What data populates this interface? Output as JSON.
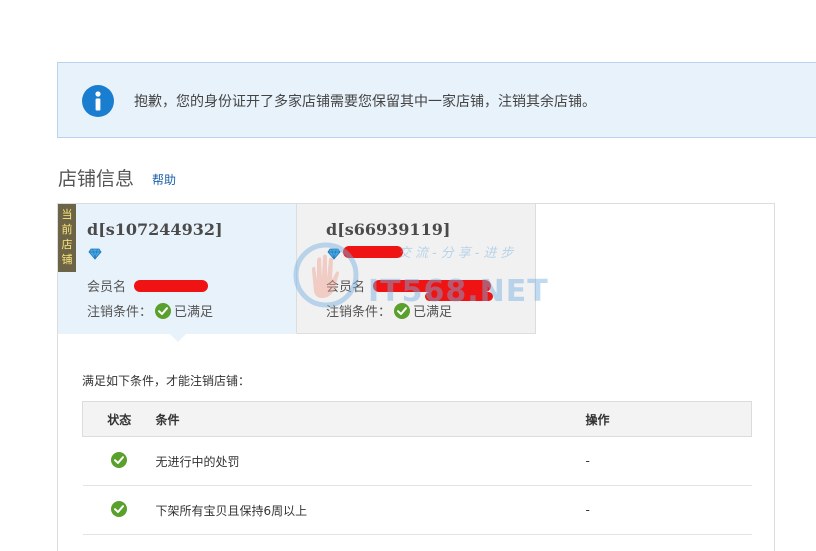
{
  "notice": {
    "icon": "info-icon",
    "message": "抱歉，您的身份证开了多家店铺需要您保留其中一家店铺，注销其余店铺。",
    "accent_color": "#1a7ed0"
  },
  "section": {
    "title": "店铺信息",
    "help_link": "帮助"
  },
  "stores": [
    {
      "badge": "当前店铺",
      "name": "d[s107244932]",
      "member_label": "会员名",
      "condition_label": "注销条件：",
      "condition_status": "已满足"
    },
    {
      "name": "d[s66939119]",
      "member_label": "会员名",
      "condition_label": "注销条件：",
      "condition_status": "已满足"
    }
  ],
  "watermark": {
    "text": "IT568.NET",
    "sub": "交流-分享-进步"
  },
  "requirements": {
    "intro": "满足如下条件，才能注销店铺：",
    "headers": {
      "status": "状态",
      "condition": "条件",
      "action": "操作"
    },
    "rows": [
      {
        "condition": "无进行中的处罚",
        "action": "-"
      },
      {
        "condition": "下架所有宝贝且保持6周以上",
        "action": "-"
      }
    ],
    "check_color": "#5aa02c"
  }
}
